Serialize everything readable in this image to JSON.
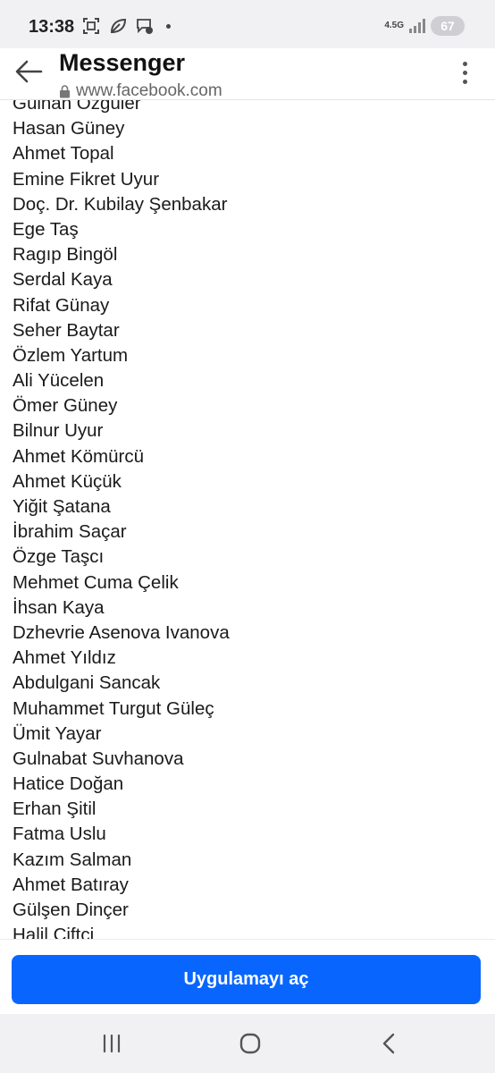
{
  "status_bar": {
    "time": "13:38",
    "network_label": "4.5G",
    "battery": "67",
    "icons": [
      "screenshot-icon",
      "leaf-icon",
      "messenger-notification-icon"
    ]
  },
  "app_bar": {
    "title": "Messenger",
    "url": "www.facebook.com",
    "back_icon": "arrow-left-icon",
    "menu_icon": "more-vertical-icon"
  },
  "names": [
    "Gülhan Özgüler",
    "Hasan Güney",
    "Ahmet Topal",
    "Emine Fikret Uyur",
    "Doç. Dr. Kubilay Şenbakar",
    "Ege Taş",
    "Ragıp Bingöl",
    "Serdal Kaya",
    "Rifat Günay",
    "Seher Baytar",
    "Özlem Yartum",
    "Ali Yücelen",
    "Ömer Güney",
    "Bilnur Uyur",
    "Ahmet Kömürcü",
    "Ahmet Küçük",
    "Yiğit Şatana",
    "İbrahim Saçar",
    "Özge Taşcı",
    "Mehmet Cuma Çelik",
    "İhsan Kaya",
    "Dzhevrie Asenova Ivanova",
    "Ahmet Yıldız",
    "Abdulgani Sancak",
    "Muhammet Turgut Güleç",
    "Ümit Yayar",
    "Gulnabat Suvhanova",
    "Hatice Doğan",
    "Erhan Şitil",
    "Fatma Uslu",
    "Kazım Salman",
    "Ahmet Batıray",
    "Gülşen Dinçer",
    "Halil Çiftçi"
  ],
  "action": {
    "open_app_label": "Uygulamayı aç"
  },
  "nav_bar": {
    "icons": [
      "recent-apps-icon",
      "home-icon",
      "back-icon"
    ]
  },
  "colors": {
    "accent": "#0866ff",
    "background": "#ffffff",
    "system_bar": "#f1f1f3"
  }
}
